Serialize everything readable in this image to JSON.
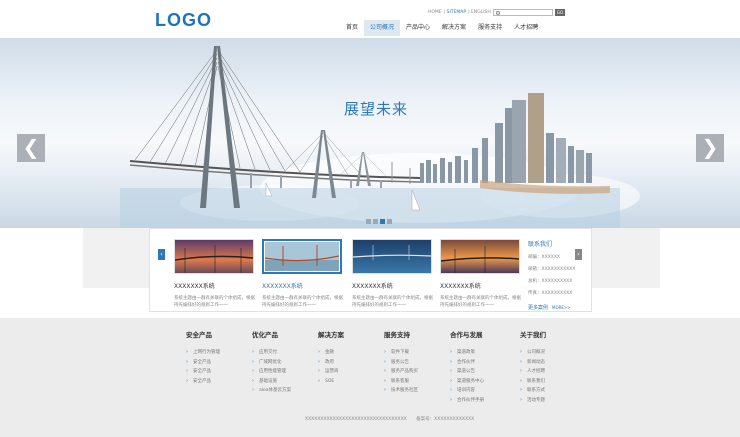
{
  "header": {
    "logo": "LOGO",
    "toplinks": [
      "HOME",
      "SITEMAP",
      "ENGLISH"
    ],
    "search_button": "GO",
    "nav": [
      "首页",
      "公司概况",
      "产品中心",
      "解决方案",
      "服务支持",
      "人才招聘"
    ],
    "active_nav_index": 1
  },
  "banner": {
    "title": "展望未来",
    "prev_glyph": "❮",
    "next_glyph": "❯",
    "slide_count": 4,
    "active_slide": 2
  },
  "products": {
    "prev_glyph": "‹",
    "next_glyph": "›",
    "items": [
      {
        "name": "XXXXXXX系统",
        "desc": "系统主题由一群有关联的个体组成，根据持先编排好的规则工作一一"
      },
      {
        "name": "XXXXXXX系统",
        "desc": "系统主题由一群有关联的个体组成，根据持先编排好的规则工作一一"
      },
      {
        "name": "XXXXXXX系统",
        "desc": "系统主题由一群有关联的个体组成，根据持先编排好的规则工作一一"
      },
      {
        "name": "XXXXXXX系统",
        "desc": "系统主题由一群有关联的个体组成，根据持先编排好的规则工作一一"
      }
    ],
    "selected_index": 1
  },
  "contact": {
    "title": "联系我们",
    "rows": [
      "邮编：XXXXXX",
      "邮箱：XXXXXXXXXXX",
      "总机：XXXXXXXXXX",
      "传真：XXXXXXXXXX"
    ],
    "more_cases": "更多案例",
    "more": "MORE>>"
  },
  "footer": {
    "columns": [
      {
        "title": "安全产品",
        "links": [
          "上网行为管理",
          "安全产品",
          "安全产品",
          "安全产品"
        ]
      },
      {
        "title": "优化产品",
        "links": [
          "应用交付",
          "广域网优化",
          "应用性能管理",
          "基础设施",
          "aloa体基云方案"
        ]
      },
      {
        "title": "解决方案",
        "links": [
          "金融",
          "政府",
          "运营商",
          "SOE"
        ]
      },
      {
        "title": "服务支持",
        "links": [
          "软件下载",
          "服务公告",
          "服务产品购买",
          "联系客服",
          "技术服务社区"
        ]
      },
      {
        "title": "合作与发展",
        "links": [
          "渠道政策",
          "合作伙伴",
          "渠道公告",
          "渠道服务中心",
          "培训内容",
          "合作伙伴手册"
        ]
      },
      {
        "title": "关于我们",
        "links": [
          "公司概况",
          "新闻动态",
          "人才招聘",
          "联系我们",
          "联系方式",
          "活动专题"
        ]
      }
    ],
    "copyright": "XXXXXXXXXXXXXXXXXXXXXXXXXXXXXXXXX",
    "icp": "备案号：XXXXXXXXXXXXX"
  }
}
